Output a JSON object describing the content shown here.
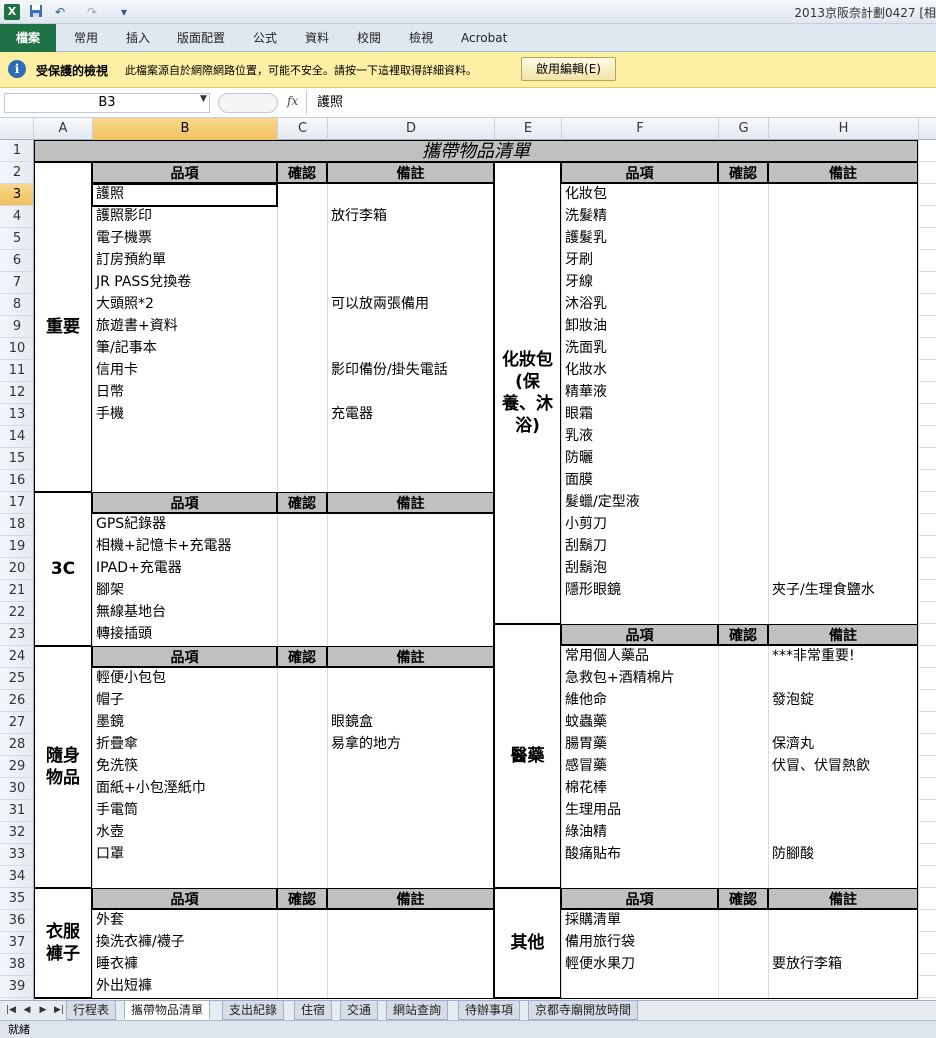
{
  "titlebar": {
    "app_icon": "X",
    "doc_title": "2013京阪奈計劃0427 [相"
  },
  "ribbon": {
    "file": "檔案",
    "tabs": [
      "常用",
      "插入",
      "版面配置",
      "公式",
      "資料",
      "校閱",
      "檢視",
      "Acrobat"
    ]
  },
  "protected_view": {
    "icon": "i",
    "title": "受保護的檢視",
    "message": "此檔案源自於網際網路位置，可能不安全。請按一下這裡取得詳細資料。",
    "button": "啟用編輯(E)"
  },
  "formula_bar": {
    "name_box": "B3",
    "fx": "fx",
    "value": "護照"
  },
  "columns": [
    "A",
    "B",
    "C",
    "D",
    "E",
    "F",
    "G",
    "H"
  ],
  "rows": [
    "1",
    "2",
    "3",
    "4",
    "5",
    "6",
    "7",
    "8",
    "9",
    "10",
    "11",
    "12",
    "13",
    "14",
    "15",
    "16",
    "17",
    "18",
    "19",
    "20",
    "21",
    "22",
    "23",
    "24",
    "25",
    "26",
    "27",
    "28",
    "29",
    "30",
    "31",
    "32",
    "33",
    "34",
    "35",
    "36",
    "37",
    "38",
    "39"
  ],
  "sheet": {
    "title": "攜帶物品清單",
    "headers": {
      "item": "品項",
      "check": "確認",
      "note": "備註"
    },
    "left_sections": [
      {
        "category": "重要",
        "items": [
          {
            "item": "護照",
            "note": ""
          },
          {
            "item": "護照影印",
            "note": "放行李箱"
          },
          {
            "item": "電子機票",
            "note": ""
          },
          {
            "item": "訂房預約單",
            "note": ""
          },
          {
            "item": "JR PASS兌換卷",
            "note": ""
          },
          {
            "item": "大頭照*2",
            "note": "可以放兩張備用"
          },
          {
            "item": "旅遊書+資料",
            "note": ""
          },
          {
            "item": "筆/記事本",
            "note": ""
          },
          {
            "item": "信用卡",
            "note": "影印備份/掛失電話"
          },
          {
            "item": "日幣",
            "note": ""
          },
          {
            "item": "手機",
            "note": "充電器"
          },
          {
            "item": "",
            "note": ""
          },
          {
            "item": "",
            "note": ""
          },
          {
            "item": "",
            "note": ""
          }
        ]
      },
      {
        "category": "3C",
        "items": [
          {
            "item": "GPS紀錄器",
            "note": ""
          },
          {
            "item": "相機+記憶卡+充電器",
            "note": ""
          },
          {
            "item": "IPAD+充電器",
            "note": ""
          },
          {
            "item": "腳架",
            "note": ""
          },
          {
            "item": "無線基地台",
            "note": ""
          },
          {
            "item": "轉接插頭",
            "note": ""
          }
        ]
      },
      {
        "category": "隨身物品",
        "items": [
          {
            "item": "輕便小包包",
            "note": ""
          },
          {
            "item": "帽子",
            "note": ""
          },
          {
            "item": "墨鏡",
            "note": "眼鏡盒"
          },
          {
            "item": "折疊傘",
            "note": "易拿的地方"
          },
          {
            "item": "免洗筷",
            "note": ""
          },
          {
            "item": "面紙+小包溼紙巾",
            "note": ""
          },
          {
            "item": "手電筒",
            "note": ""
          },
          {
            "item": "水壺",
            "note": ""
          },
          {
            "item": "口罩",
            "note": ""
          },
          {
            "item": "",
            "note": ""
          }
        ]
      },
      {
        "category": "衣服褲子",
        "items": [
          {
            "item": "外套",
            "note": ""
          },
          {
            "item": "換洗衣褲/襪子",
            "note": ""
          },
          {
            "item": "睡衣褲",
            "note": ""
          },
          {
            "item": "外出短褲",
            "note": ""
          }
        ]
      }
    ],
    "right_sections": [
      {
        "category": "化妝包(保養、沐浴)",
        "items": [
          {
            "item": "化妝包",
            "note": ""
          },
          {
            "item": "洗髮精",
            "note": ""
          },
          {
            "item": "護髮乳",
            "note": ""
          },
          {
            "item": "牙刷",
            "note": ""
          },
          {
            "item": "牙線",
            "note": ""
          },
          {
            "item": "沐浴乳",
            "note": ""
          },
          {
            "item": "卸妝油",
            "note": ""
          },
          {
            "item": "洗面乳",
            "note": ""
          },
          {
            "item": "化妝水",
            "note": ""
          },
          {
            "item": "精華液",
            "note": ""
          },
          {
            "item": "眼霜",
            "note": ""
          },
          {
            "item": "乳液",
            "note": ""
          },
          {
            "item": "防曬",
            "note": ""
          },
          {
            "item": "面膜",
            "note": ""
          },
          {
            "item": "髮蠟/定型液",
            "note": ""
          },
          {
            "item": "小剪刀",
            "note": ""
          },
          {
            "item": "刮鬍刀",
            "note": ""
          },
          {
            "item": "刮鬍泡",
            "note": ""
          },
          {
            "item": "隱形眼鏡",
            "note": "夾子/生理食鹽水"
          },
          {
            "item": "",
            "note": ""
          }
        ]
      },
      {
        "category": "醫藥",
        "items": [
          {
            "item": "常用個人藥品",
            "note": "***非常重要!"
          },
          {
            "item": "急救包+酒精棉片",
            "note": ""
          },
          {
            "item": "維他命",
            "note": "發泡錠"
          },
          {
            "item": "蚊蟲藥",
            "note": ""
          },
          {
            "item": "腸胃藥",
            "note": "保濟丸"
          },
          {
            "item": "感冒藥",
            "note": "伏冒、伏冒熱飲"
          },
          {
            "item": "棉花棒",
            "note": ""
          },
          {
            "item": "生理用品",
            "note": ""
          },
          {
            "item": "綠油精",
            "note": ""
          },
          {
            "item": "酸痛貼布",
            "note": "防腳酸"
          },
          {
            "item": "",
            "note": ""
          }
        ]
      },
      {
        "category": "其他",
        "items": [
          {
            "item": "採購清單",
            "note": ""
          },
          {
            "item": "備用旅行袋",
            "note": ""
          },
          {
            "item": "輕便水果刀",
            "note": "要放行李箱"
          },
          {
            "item": "",
            "note": ""
          }
        ]
      }
    ]
  },
  "sheet_tabs": [
    "行程表",
    "攜帶物品清單",
    "支出紀錄",
    "住宿",
    "交通",
    "網站查詢",
    "待辦事項",
    "京都寺廟開放時間"
  ],
  "active_sheet": "攜帶物品清單",
  "status": "就緒"
}
